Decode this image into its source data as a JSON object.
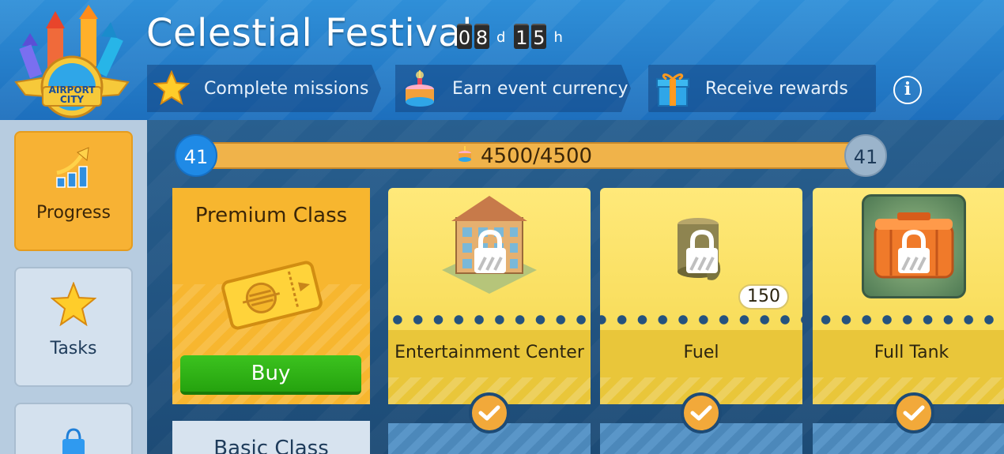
{
  "header": {
    "title": "Celestial Festival",
    "logo_line1": "AIRPORT",
    "logo_line2": "CITY",
    "timer": {
      "d1": "0",
      "d2": "8",
      "unit1": "d",
      "h1": "1",
      "h2": "5",
      "unit2": "h"
    },
    "steps": [
      {
        "label": "Complete missions",
        "icon": "star-icon"
      },
      {
        "label": "Earn event currency",
        "icon": "cake-icon"
      },
      {
        "label": "Receive rewards",
        "icon": "gift-icon"
      }
    ],
    "info_label": "i"
  },
  "sidebar": {
    "tabs": [
      {
        "label": "Progress",
        "icon": "progress-chart-icon",
        "active": true
      },
      {
        "label": "Tasks",
        "icon": "star-icon",
        "active": false
      },
      {
        "label": "",
        "icon": "shopping-bag-icon",
        "active": false
      }
    ]
  },
  "progress": {
    "level_current": "41",
    "level_next": "41",
    "value_text": "4500/4500",
    "fraction": 1.0
  },
  "tiers": {
    "premium_title": "Premium Class",
    "buy_label": "Buy",
    "basic_title": "Basic Class"
  },
  "rewards": [
    {
      "label": "Entertainment Center",
      "icon": "building-icon",
      "locked": true,
      "claimed": true
    },
    {
      "label": "Fuel",
      "icon": "fuel-barrel-icon",
      "locked": true,
      "claimed": true,
      "quantity": "150"
    },
    {
      "label": "Full Tank",
      "icon": "fuel-tank-icon",
      "locked": true,
      "claimed": true
    }
  ],
  "colors": {
    "header_blue": "#1d6fbd",
    "accent_orange": "#f7b234",
    "buy_green": "#25a30e",
    "level_blue": "#1f8ae6"
  }
}
